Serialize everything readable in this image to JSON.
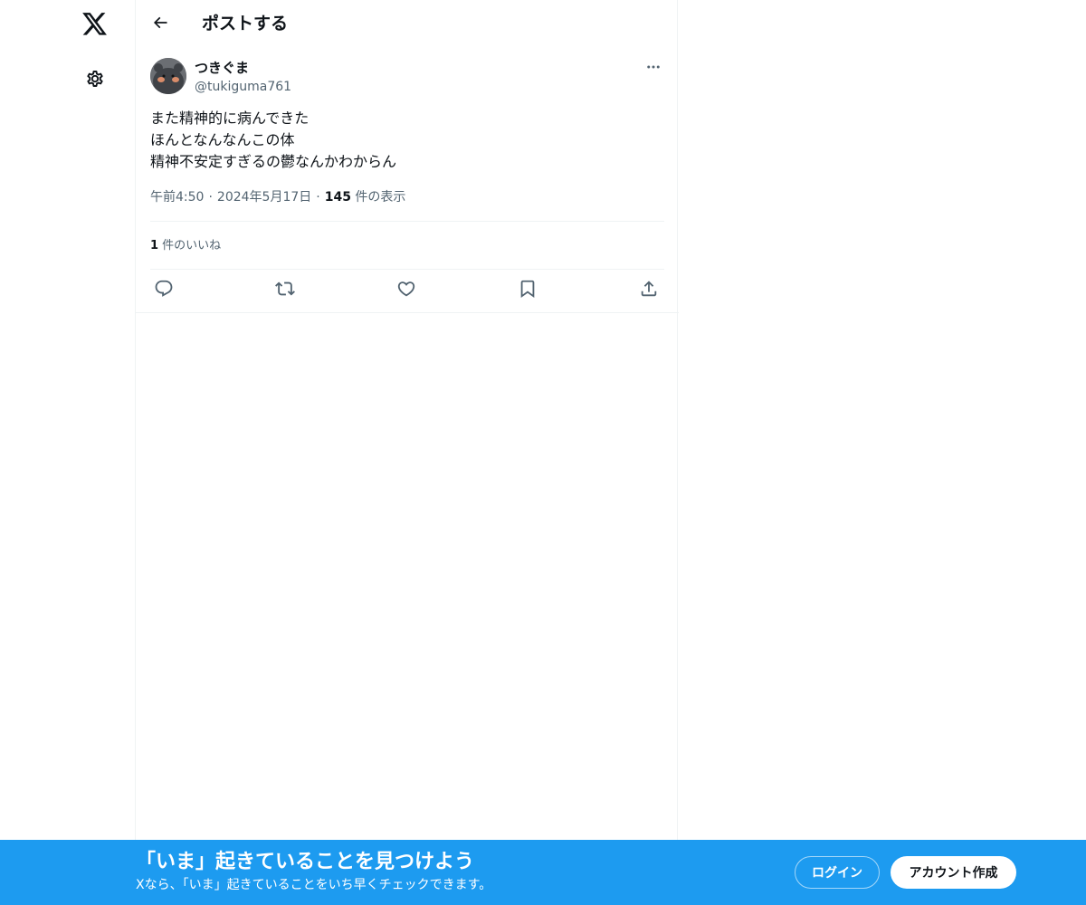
{
  "nav": {
    "logo_icon": "x-logo-icon",
    "settings_icon": "gear-icon"
  },
  "header": {
    "title": "ポストする",
    "back_icon": "arrow-left-icon"
  },
  "post": {
    "author_name": "つきぐま",
    "author_handle": "@tukiguma761",
    "more_icon": "ellipsis-icon",
    "text_lines": [
      "また精神的に病んできた",
      "ほんとなんなんこの体",
      "精神不安定すぎるの鬱なんかわからん"
    ],
    "time": "午前4:50",
    "date": "2024年5月17日",
    "views_count": "145",
    "views_label": " 件の表示",
    "likes_count": "1",
    "likes_label": " 件のいいね",
    "actions": {
      "reply_icon": "reply-icon",
      "repost_icon": "repost-icon",
      "like_icon": "heart-icon",
      "bookmark_icon": "bookmark-icon",
      "share_icon": "share-icon"
    }
  },
  "banner": {
    "title": "「いま」起きていることを見つけよう",
    "subtitle": "Xなら、「いま」起きていることをいち早くチェックできます。",
    "login_label": "ログイン",
    "signup_label": "アカウント作成",
    "background_color": "#1d9bf0"
  }
}
